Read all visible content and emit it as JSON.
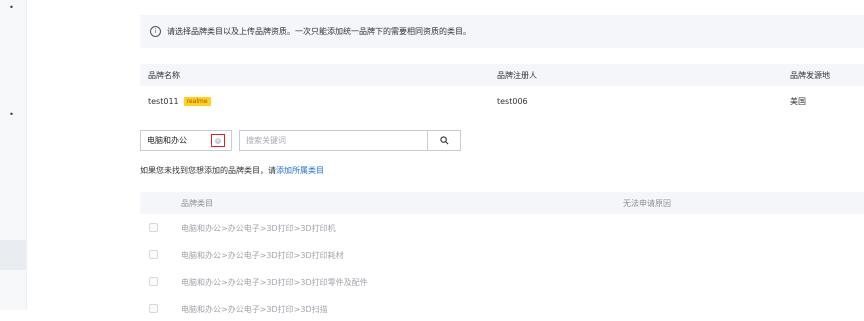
{
  "notice": {
    "icon": "info-icon",
    "text": "请选择品牌类目以及上传品牌资质。一次只能添加统一品牌下的需要相同资质的类目。"
  },
  "brand_table": {
    "headers": [
      "品牌名称",
      "品牌注册人",
      "品牌发源地"
    ],
    "row": {
      "name": "test011",
      "tag": "realme",
      "registrant": "test006",
      "origin": "美国"
    }
  },
  "category_select": {
    "value": "电脑和办公"
  },
  "search": {
    "placeholder": "搜索关键词",
    "icon": "search-icon"
  },
  "hint": {
    "text": "如果您未找到您想添加的品牌类目，请",
    "link": "添加所属类目"
  },
  "category_table": {
    "headers": [
      "品牌类目",
      "无法申请原因"
    ],
    "rows": [
      "电脑和办公>办公电子>3D打印>3D打印机",
      "电脑和办公>办公电子>3D打印>3D打印耗材",
      "电脑和办公>办公电子>3D打印>3D打印零件及配件",
      "电脑和办公>办公电子>3D打印>3D扫描"
    ]
  },
  "colors": {
    "accent_link": "#1a6fd4",
    "tag_bg": "#ffd21f",
    "highlight_border": "#e02020"
  }
}
